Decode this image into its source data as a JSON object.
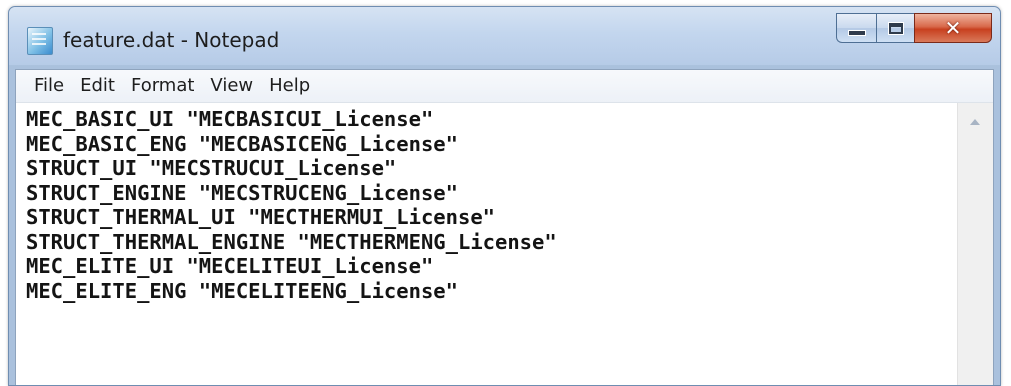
{
  "window": {
    "title": "feature.dat - Notepad"
  },
  "menu": {
    "items": [
      {
        "label": "File"
      },
      {
        "label": "Edit"
      },
      {
        "label": "Format"
      },
      {
        "label": "View"
      },
      {
        "label": "Help"
      }
    ]
  },
  "editor": {
    "lines": [
      "MEC_BASIC_UI \"MECBASICUI_License\"",
      "MEC_BASIC_ENG \"MECBASICENG_License\"",
      "STRUCT_UI \"MECSTRUCUI_License\"",
      "STRUCT_ENGINE \"MECSTRUCENG_License\"",
      "STRUCT_THERMAL_UI \"MECTHERMUI_License\"",
      "STRUCT_THERMAL_ENGINE \"MECTHERMENG_License\"",
      "MEC_ELITE_UI \"MECELITEUI_License\"",
      "MEC_ELITE_ENG \"MECELITEENG_License\""
    ]
  },
  "icons": {
    "app": "notepad-icon",
    "minimize": "minimize-icon",
    "maximize": "maximize-icon",
    "close": "close-icon",
    "scroll_up": "scroll-up-arrow-icon"
  },
  "colors": {
    "close_button": "#c8401f",
    "title_bar": "#c3d6ee"
  }
}
